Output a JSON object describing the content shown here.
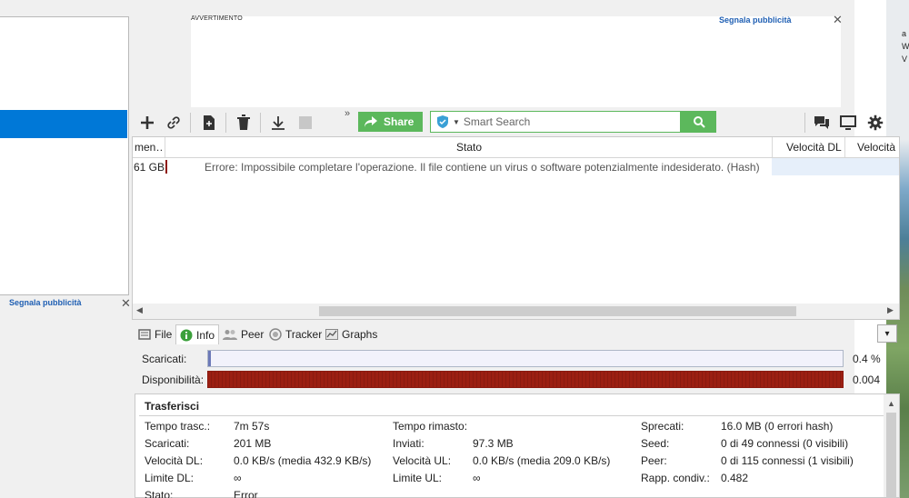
{
  "ad": {
    "label": "AVVERTIMENTO",
    "report_link": "Segnala pubblicità",
    "close": "✕"
  },
  "left_panel": {
    "report_link": "Segnala pubblicità",
    "close": "✕"
  },
  "desktop": {
    "fragments": [
      "a",
      "W",
      "V"
    ]
  },
  "toolbar": {
    "share_label": "Share",
    "more": "»",
    "search_placeholder": "Smart Search"
  },
  "torrent_list": {
    "columns": [
      "men…",
      "Stato",
      "Velocità DL",
      "Velocità U"
    ],
    "rows": [
      {
        "size": "61 GB",
        "status": "Errore: Impossibile completare l'operazione. Il file contiene un virus o software potenzialmente indesiderato.  (Hash)"
      }
    ]
  },
  "tabs": [
    {
      "label": "File",
      "icon": "file-icon",
      "active": false
    },
    {
      "label": "Info",
      "icon": "info-icon",
      "active": true
    },
    {
      "label": "Peer",
      "icon": "peers-icon",
      "active": false
    },
    {
      "label": "Tracker",
      "icon": "tracker-icon",
      "active": false
    },
    {
      "label": "Graphs",
      "icon": "graph-icon",
      "active": false
    }
  ],
  "progress": {
    "downloaded_label": "Scaricati:",
    "downloaded_value": "0.4 %",
    "downloaded_fraction": 0.004,
    "availability_label": "Disponibilità:",
    "availability_value": "0.004"
  },
  "transfers": {
    "title": "Trasferisci",
    "col1": [
      {
        "label": "Tempo trasc.:",
        "value": "7m 57s"
      },
      {
        "label": "Scaricati:",
        "value": "201 MB"
      },
      {
        "label": "Velocità DL:",
        "value": "0.0 KB/s (media 432.9 KB/s)"
      },
      {
        "label": "Limite DL:",
        "value": "∞"
      },
      {
        "label": "Stato:",
        "value": "Error"
      }
    ],
    "col2": [
      {
        "label": "Tempo rimasto:",
        "value": ""
      },
      {
        "label": "Inviati:",
        "value": "97.3 MB"
      },
      {
        "label": "Velocità UL:",
        "value": "0.0 KB/s (media 209.0 KB/s)"
      },
      {
        "label": "Limite UL:",
        "value": "∞"
      }
    ],
    "col3": [
      {
        "label": "Sprecati:",
        "value": "16.0 MB (0 errori hash)"
      },
      {
        "label": "Seed:",
        "value": "0 di 49 connessi (0 visibili)"
      },
      {
        "label": "Peer:",
        "value": "0 di 115 connessi (1 visibili)"
      },
      {
        "label": "Rapp. condiv.:",
        "value": "0.482"
      }
    ]
  },
  "colors": {
    "accent_green": "#5cb85c",
    "selection_blue": "#0078d7",
    "link_blue": "#1f5fb3",
    "availability_red": "#9b1f12",
    "progress_blue": "#6c79b8"
  }
}
